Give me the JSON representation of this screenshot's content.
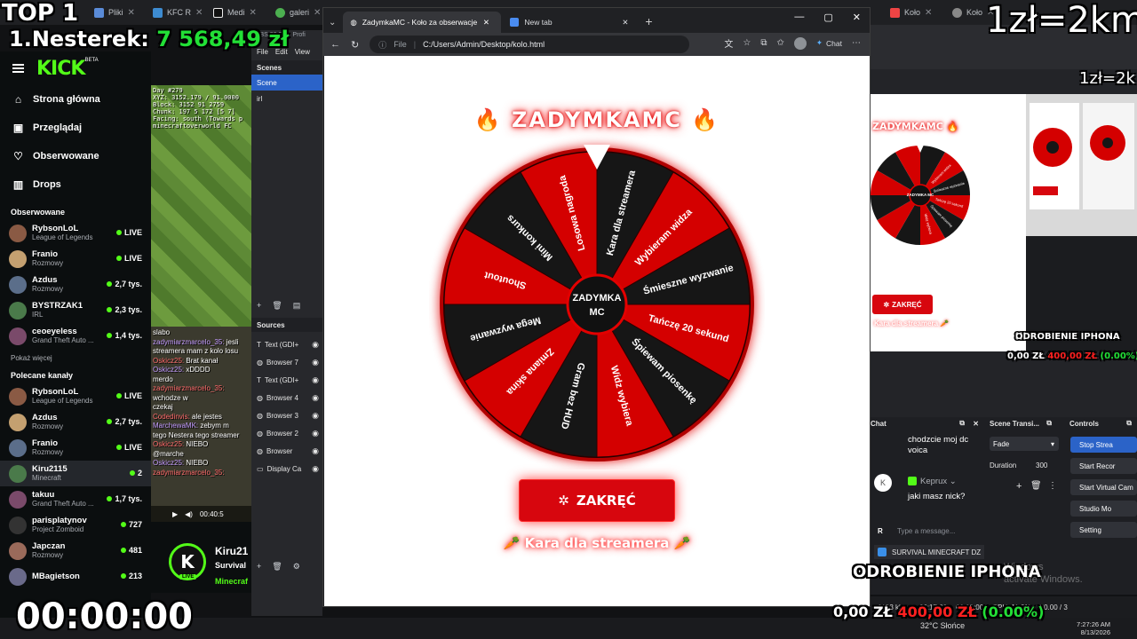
{
  "overlay": {
    "top_label": "TOP 1",
    "ranking_name": "1.Nesterek:",
    "ranking_amount": "7 568,49 zł",
    "rate": "1zł=2km",
    "rate_small": "1zł=2k",
    "timer": "00:00:00",
    "donation_left": "0,00 ZŁ",
    "donation_mid": "400,00 ZŁ",
    "donation_pct": "(0.00%)",
    "goal_label": "ODROBIENIE IPHONA",
    "goal_label_small": "ODROBIENIE IPHONA",
    "windows_watermark_1": "Windows",
    "windows_watermark_2": "activate Windows."
  },
  "bg_tabs": [
    {
      "label": "Pliki"
    },
    {
      "label": "KFC R"
    },
    {
      "label": "Medi"
    },
    {
      "label": "galeri"
    },
    {
      "label": "Koło"
    },
    {
      "label": "Koło"
    }
  ],
  "kick": {
    "logo": "KICK",
    "beta": "BETA",
    "nav": [
      {
        "label": "Strona główna",
        "icon": "home-icon"
      },
      {
        "label": "Przeglądaj",
        "icon": "browse-icon"
      },
      {
        "label": "Obserwowane",
        "icon": "heart-icon"
      },
      {
        "label": "Drops",
        "icon": "drops-icon"
      }
    ],
    "followed_title": "Obserwowane",
    "followed": [
      {
        "name": "RybsonLoL",
        "game": "League of Legends",
        "viewers": "LIVE"
      },
      {
        "name": "Franio",
        "game": "Rozmowy",
        "viewers": "LIVE"
      },
      {
        "name": "Azdus",
        "game": "Rozmowy",
        "viewers": "2,7 tys."
      },
      {
        "name": "BYSTRZAK1",
        "game": "IRL",
        "viewers": "2,3 tys."
      },
      {
        "name": "ceoeyeless",
        "game": "Grand Theft Auto ...",
        "viewers": "1,4 tys."
      }
    ],
    "show_more": "Pokaż więcej",
    "recommended_title": "Polecane kanały",
    "recommended": [
      {
        "name": "RybsonLoL",
        "game": "League of Legends",
        "viewers": "LIVE"
      },
      {
        "name": "Azdus",
        "game": "Rozmowy",
        "viewers": "2,7 tys."
      },
      {
        "name": "Franio",
        "game": "Rozmowy",
        "viewers": "LIVE"
      },
      {
        "name": "Kiru2115",
        "game": "Minecraft",
        "viewers": "2"
      },
      {
        "name": "takuu",
        "game": "Grand Theft Auto ...",
        "viewers": "1,7 tys."
      },
      {
        "name": "parisplatynov",
        "game": "Project Zomboid",
        "viewers": "727"
      },
      {
        "name": "Japczan",
        "game": "Rozmowy",
        "viewers": "481"
      },
      {
        "name": "MBagietson",
        "game": "",
        "viewers": "213"
      }
    ]
  },
  "stream": {
    "hud_lines": [
      "Day #279",
      "XYZ: 3152.179 / 91.0000",
      "Block: 3152 91 2759",
      "Chunk: 197 5 172 [5 7]",
      "Facing: south (Towards p",
      "minecraftoverworld FC"
    ],
    "chat_lines": [
      {
        "user": "",
        "text": "slabo"
      },
      {
        "user": "zadymiarzmarcelo_35:",
        "text": "jesli"
      },
      {
        "user": "",
        "text": "streamera mam z kolo losu"
      },
      {
        "user": "Oskicz25:",
        "text": "Brat kanał"
      },
      {
        "user": "Oskicz25:",
        "text": "xDDDD"
      },
      {
        "user": "",
        "text": "merdo"
      },
      {
        "user": "zadymiarzmarcelo_35:",
        "text": ""
      },
      {
        "user": "",
        "text": "wchodze w"
      },
      {
        "user": "",
        "text": "czekaj"
      },
      {
        "user": "Codedinvis:",
        "text": "ale jestes"
      },
      {
        "user": "MarchewaMK:",
        "text": "zebym m"
      },
      {
        "user": "",
        "text": "tego Nestera tego streamer"
      },
      {
        "user": "Oskicz25:",
        "text": "NIEBO"
      },
      {
        "user": "",
        "text": "@marche"
      },
      {
        "user": "Oskicz25:",
        "text": "NIEBO"
      },
      {
        "user": "zadymiarzmarcelo_35:",
        "text": ""
      }
    ],
    "player_time": "00:40:5",
    "streamer_name": "Kiru21",
    "streamer_title": "Survival",
    "streamer_game": "Minecraf",
    "live": "LIVE"
  },
  "obs": {
    "title": "OBS 32.2.1 - Profi",
    "menu": [
      "File",
      "Edit",
      "View"
    ],
    "scenes_label": "Scenes",
    "scenes": [
      "Scene",
      "irl"
    ],
    "sources_label": "Sources",
    "sources": [
      "Text (GDI+",
      "Browser 7",
      "Text (GDI+",
      "Browser 4",
      "Browser 3",
      "Browser 2",
      "Browser",
      "Display Ca"
    ]
  },
  "browser": {
    "tab_active": "ZadymkaMC - Koło za obserwacje",
    "tab_new": "New tab",
    "url_prefix": "File",
    "url": "C:/Users/Admin/Desktop/kolo.html",
    "chat_label": "Chat"
  },
  "wheel": {
    "title": "ZADYMKAMC",
    "center_line1": "ZADYMKA",
    "center_line2": "MC",
    "segments": [
      "Kara dla streamera",
      "Wybieram widza",
      "Śmieszne wyzwanie",
      "Tańczę 20 sekund",
      "Śpiewam piosenkę",
      "Widz wybiera",
      "Gram bez HUD",
      "Zmiana skina",
      "Mega wyzwanie",
      "Shoutout",
      "Mini konkurs",
      "Losowa nagroda"
    ],
    "colors": {
      "red": "#d40000",
      "dark": "#161616",
      "rim": "#b10000",
      "accent": "#e30000"
    },
    "spin_button": "ZAKRĘĆ",
    "result": "Kara dla streamera"
  },
  "mini": {
    "title": "ZADYMKAMC",
    "center": "ZADYMKA MC",
    "button": "ZAKRĘĆ",
    "result": "Kara dla streamera",
    "seg_labels": [
      "Wybieram widza",
      "Śmieszne wyzwanie",
      "Tańczę 20 sekund",
      "Śpiewam piosenkę",
      "Widz wybiera"
    ]
  },
  "chat_dock": {
    "title": "Chat",
    "msg1": "chodzcie moj dc voica",
    "user2": "Keprux",
    "avatar_letter": "K",
    "msg2": "jaki masz nick?",
    "input_letter": "R",
    "input_placeholder": "Type a message..."
  },
  "stream_title_bar": "SURVIVAL MINECRAFT DZ",
  "transitions": {
    "title": "Scene Transi...",
    "type": "Fade",
    "duration_label": "Duration",
    "duration_value": "300"
  },
  "controls": {
    "title": "Controls",
    "buttons": [
      "Stop Strea",
      "Start Recor",
      "Start Virtual Cam",
      "Studio Mo",
      "Setting"
    ]
  },
  "status": {
    "kbps": "6183 kbps",
    "time1": "00:17:06",
    "time2": "00:00:00",
    "cpu": "CPU: 11.8%",
    "fps": "30.00 / 3"
  },
  "taskbar": {
    "weather": "32°C  Słońce",
    "time": "7:27:26 AM",
    "date": "8/13/2026"
  }
}
